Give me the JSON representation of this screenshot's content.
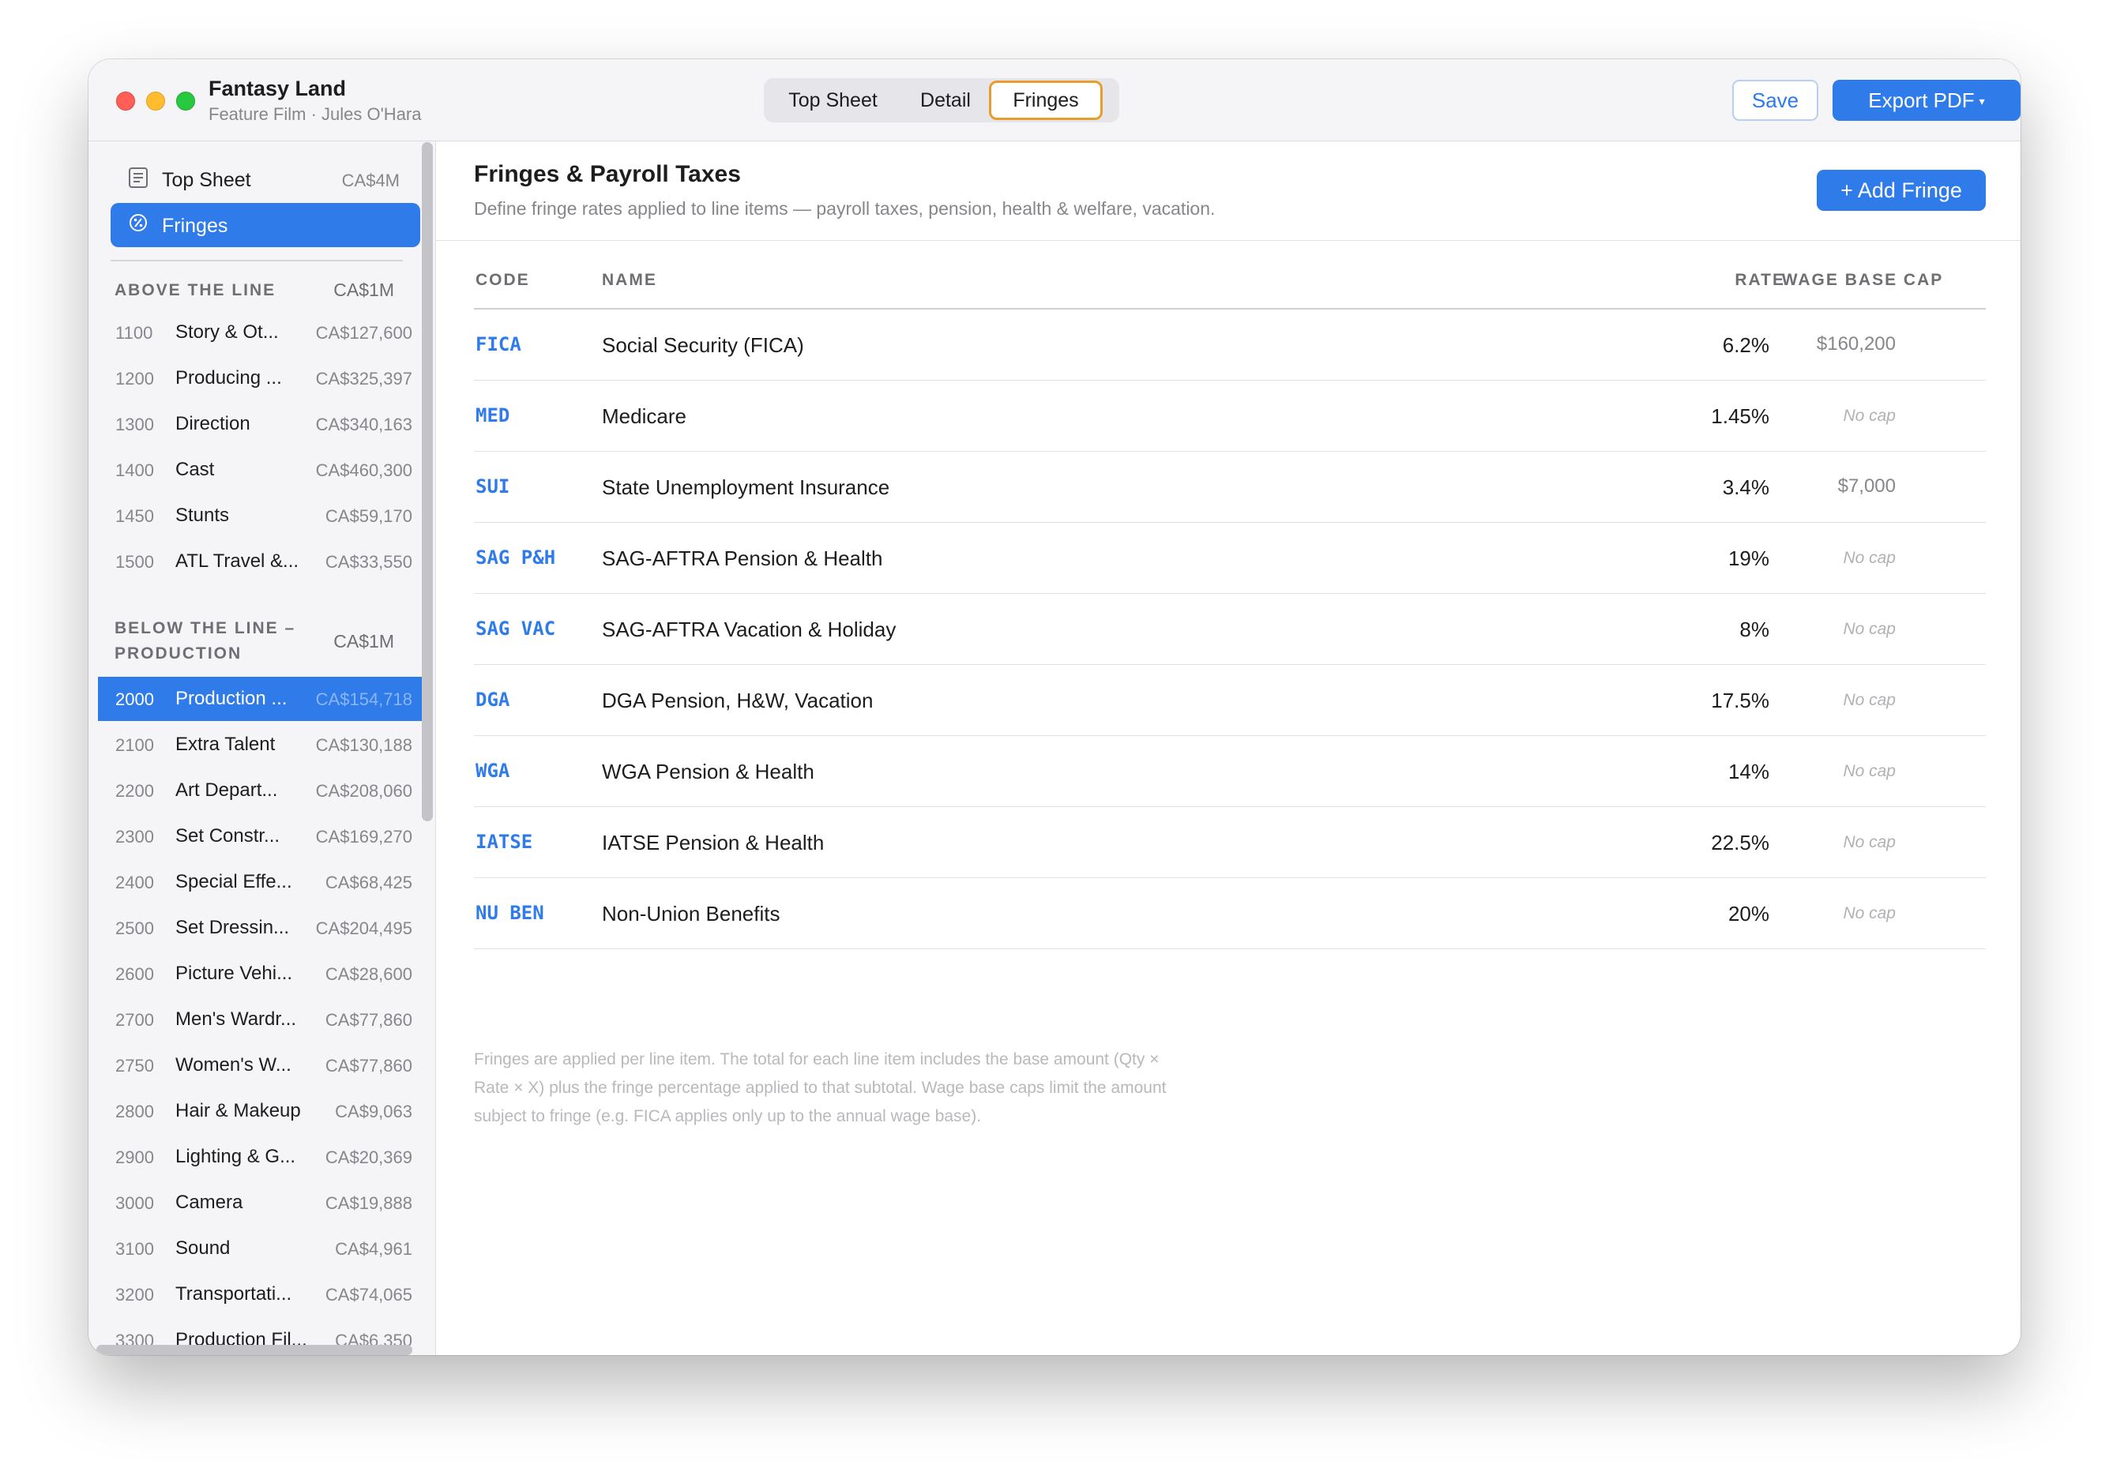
{
  "window": {
    "title": "Fantasy Land",
    "subtitle": "Feature Film · Jules O'Hara"
  },
  "tabs": [
    {
      "label": "Top Sheet",
      "active": false
    },
    {
      "label": "Detail",
      "active": false
    },
    {
      "label": "Fringes",
      "active": true
    }
  ],
  "toolbar": {
    "save_label": "Save",
    "export_label": "Export PDF",
    "export_caret": "▾"
  },
  "colors": {
    "accent": "#2f7bea",
    "active_tab_border": "#e79d2c",
    "close": "#ff5f57",
    "minimize": "#febc2e",
    "zoom": "#28c840"
  },
  "sidebar": {
    "nav": [
      {
        "label": "Top Sheet",
        "amount": "CA$4M",
        "icon": "document-icon"
      },
      {
        "label": "Fringes",
        "amount": "",
        "icon": "percent-badge-icon",
        "selected": true
      }
    ],
    "sections": [
      {
        "title": "ABOVE THE LINE",
        "amount": "CA$1M",
        "accounts": [
          {
            "code": "1100",
            "name": "Story & Ot...",
            "amount": "CA$127,600"
          },
          {
            "code": "1200",
            "name": "Producing ...",
            "amount": "CA$325,397"
          },
          {
            "code": "1300",
            "name": "Direction",
            "amount": "CA$340,163"
          },
          {
            "code": "1400",
            "name": "Cast",
            "amount": "CA$460,300"
          },
          {
            "code": "1450",
            "name": "Stunts",
            "amount": "CA$59,170"
          },
          {
            "code": "1500",
            "name": "ATL Travel &...",
            "amount": "CA$33,550"
          }
        ]
      },
      {
        "title_line1": "BELOW THE LINE –",
        "title_line2": "PRODUCTION",
        "amount": "CA$1M",
        "accounts": [
          {
            "code": "2000",
            "name": "Production ...",
            "amount": "CA$154,718",
            "selected": true
          },
          {
            "code": "2100",
            "name": "Extra Talent",
            "amount": "CA$130,188"
          },
          {
            "code": "2200",
            "name": "Art Depart...",
            "amount": "CA$208,060"
          },
          {
            "code": "2300",
            "name": "Set Constr...",
            "amount": "CA$169,270"
          },
          {
            "code": "2400",
            "name": "Special Effe...",
            "amount": "CA$68,425"
          },
          {
            "code": "2500",
            "name": "Set Dressin...",
            "amount": "CA$204,495"
          },
          {
            "code": "2600",
            "name": "Picture Vehi...",
            "amount": "CA$28,600"
          },
          {
            "code": "2700",
            "name": "Men's Wardr...",
            "amount": "CA$77,860"
          },
          {
            "code": "2750",
            "name": "Women's W...",
            "amount": "CA$77,860"
          },
          {
            "code": "2800",
            "name": "Hair & Makeup",
            "amount": "CA$9,063"
          },
          {
            "code": "2900",
            "name": "Lighting & G...",
            "amount": "CA$20,369"
          },
          {
            "code": "3000",
            "name": "Camera",
            "amount": "CA$19,888"
          },
          {
            "code": "3100",
            "name": "Sound",
            "amount": "CA$4,961"
          },
          {
            "code": "3200",
            "name": "Transportati...",
            "amount": "CA$74,065"
          },
          {
            "code": "3300",
            "name": "Production Fil...",
            "amount": "CA$6,350"
          }
        ]
      }
    ]
  },
  "main": {
    "title": "Fringes & Payroll Taxes",
    "description": "Define fringe rates applied to line items — payroll taxes, pension, health & welfare, vacation.",
    "add_button": "+ Add Fringe",
    "columns": {
      "code": "CODE",
      "name": "NAME",
      "rate": "RATE",
      "cap": "WAGE BASE CAP"
    },
    "rows": [
      {
        "code": "FICA",
        "name": "Social Security (FICA)",
        "rate": "6.2%",
        "cap": "$160,200",
        "nocap": false
      },
      {
        "code": "MED",
        "name": "Medicare",
        "rate": "1.45%",
        "cap": "No cap",
        "nocap": true
      },
      {
        "code": "SUI",
        "name": "State Unemployment Insurance",
        "rate": "3.4%",
        "cap": "$7,000",
        "nocap": false
      },
      {
        "code": "SAG P&H",
        "name": "SAG-AFTRA Pension & Health",
        "rate": "19%",
        "cap": "No cap",
        "nocap": true
      },
      {
        "code": "SAG VAC",
        "name": "SAG-AFTRA Vacation & Holiday",
        "rate": "8%",
        "cap": "No cap",
        "nocap": true
      },
      {
        "code": "DGA",
        "name": "DGA Pension, H&W, Vacation",
        "rate": "17.5%",
        "cap": "No cap",
        "nocap": true
      },
      {
        "code": "WGA",
        "name": "WGA Pension & Health",
        "rate": "14%",
        "cap": "No cap",
        "nocap": true
      },
      {
        "code": "IATSE",
        "name": "IATSE Pension & Health",
        "rate": "22.5%",
        "cap": "No cap",
        "nocap": true
      },
      {
        "code": "NU BEN",
        "name": "Non-Union Benefits",
        "rate": "20%",
        "cap": "No cap",
        "nocap": true
      }
    ],
    "footnote_lines": [
      "Fringes are applied per line item. The total for each line item includes the base amount (Qty ×",
      "Rate × X) plus the fringe percentage applied to that subtotal. Wage base caps limit the amount",
      "subject to fringe (e.g. FICA applies only up to the annual wage base)."
    ]
  }
}
